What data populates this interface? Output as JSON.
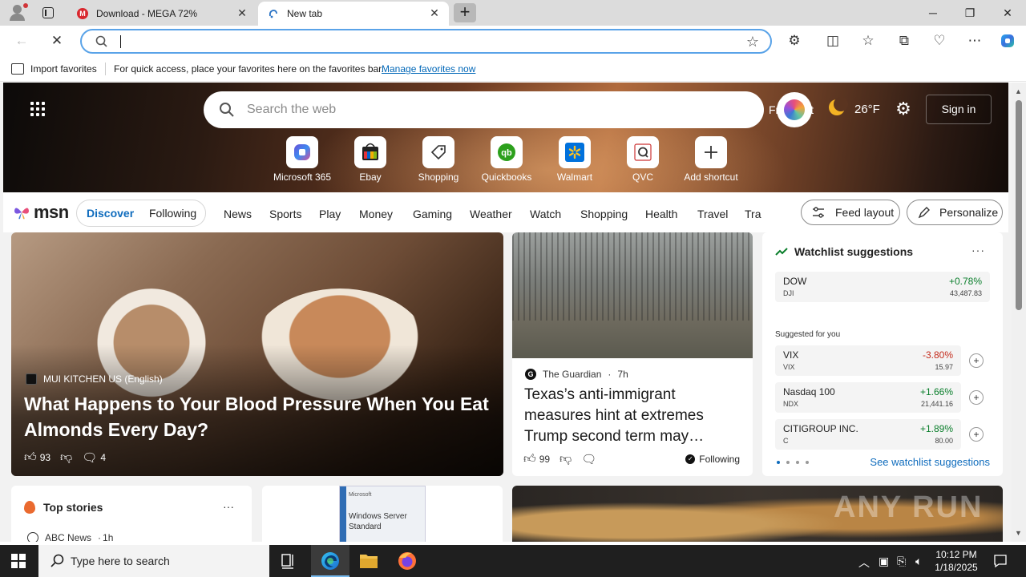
{
  "browser": {
    "tabs": [
      {
        "title": "Download - MEGA 72%",
        "favicon": "mega-icon",
        "active": false
      },
      {
        "title": "New tab",
        "favicon": "edge-newtab-icon",
        "active": true
      }
    ],
    "address": {
      "value": "",
      "placeholder": ""
    },
    "window_controls": [
      "minimize",
      "restore",
      "close"
    ]
  },
  "favorites_bar": {
    "import_label": "Import favorites",
    "tip": "For quick access, place your favorites here on the favorites bar.",
    "manage_link": "Manage favorites now"
  },
  "hero": {
    "search_placeholder": "Search the web",
    "weather": {
      "city": "Frankfurt",
      "temp": "26°F",
      "icon": "moon-icon"
    },
    "signin_label": "Sign in",
    "shortcuts": [
      {
        "name": "Microsoft 365",
        "icon": "microsoft365-icon"
      },
      {
        "name": "Ebay",
        "icon": "ebay-icon"
      },
      {
        "name": "Shopping",
        "icon": "shopping-tag-icon"
      },
      {
        "name": "Quickbooks",
        "icon": "quickbooks-icon"
      },
      {
        "name": "Walmart",
        "icon": "walmart-icon"
      },
      {
        "name": "QVC",
        "icon": "qvc-icon"
      },
      {
        "name": "Add shortcut",
        "icon": "plus-icon"
      }
    ]
  },
  "nav": {
    "logo": "msn",
    "segments": [
      "Discover",
      "Following"
    ],
    "links": [
      "News",
      "Sports",
      "Play",
      "Money",
      "Gaming",
      "Weather",
      "Watch",
      "Shopping",
      "Health",
      "Travel",
      "Trai"
    ],
    "feed_layout": "Feed layout",
    "personalize": "Personalize"
  },
  "main_story": {
    "source": "MUI KITCHEN US (English)",
    "headline": "What Happens to Your Blood Pressure When You Eat Almonds Every Day?",
    "likes": "93",
    "comments": "4"
  },
  "side_story": {
    "source": "The Guardian",
    "age": "7h",
    "headline": "Texas’s anti-immigrant measures hint at extremes Trump second term may…",
    "likes": "99",
    "following": "Following"
  },
  "watchlist": {
    "title": "Watchlist suggestions",
    "main": {
      "name": "DOW",
      "symbol": "DJI",
      "change": "+0.78%",
      "price": "43,487.83"
    },
    "suggested_label": "Suggested for you",
    "suggested": [
      {
        "name": "VIX",
        "symbol": "VIX",
        "change": "-3.80%",
        "price": "15.97",
        "direction": "down"
      },
      {
        "name": "Nasdaq 100",
        "symbol": "NDX",
        "change": "+1.66%",
        "price": "21,441.16",
        "direction": "up"
      },
      {
        "name": "CITIGROUP INC.",
        "symbol": "C",
        "change": "+1.89%",
        "price": "80.00",
        "direction": "up"
      }
    ],
    "see_link": "See watchlist suggestions",
    "colors": {
      "positive": "#0a7e2b",
      "negative": "#c42b1c"
    }
  },
  "top_stories": {
    "title": "Top stories",
    "source": "ABC News",
    "age": "1h"
  },
  "ad": {
    "brand": "Microsoft",
    "product": "Windows Server Standard"
  },
  "watermark": "ANY RUN",
  "taskbar": {
    "search_placeholder": "Type here to search",
    "time": "10:12 PM",
    "date": "1/18/2025"
  }
}
